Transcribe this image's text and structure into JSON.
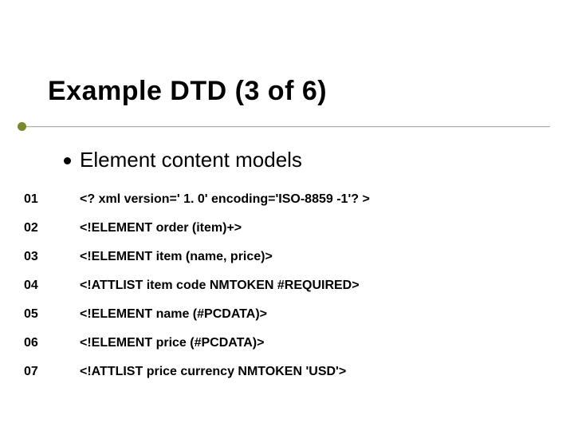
{
  "title": "Example DTD (3 of 6)",
  "subhead": "Element content models",
  "rows": [
    {
      "num": "01",
      "code": "<? xml version=' 1. 0' encoding='ISO-8859 -1'? >"
    },
    {
      "num": "02",
      "code": "<!ELEMENT order (item)+>"
    },
    {
      "num": "03",
      "code": "<!ELEMENT item (name, price)>"
    },
    {
      "num": "04",
      "code": "<!ATTLIST item code NMTOKEN #REQUIRED>"
    },
    {
      "num": "05",
      "code": "<!ELEMENT name (#PCDATA)>"
    },
    {
      "num": "06",
      "code": "<!ELEMENT price (#PCDATA)>"
    },
    {
      "num": "07",
      "code": "<!ATTLIST price currency NMTOKEN 'USD'>"
    }
  ]
}
